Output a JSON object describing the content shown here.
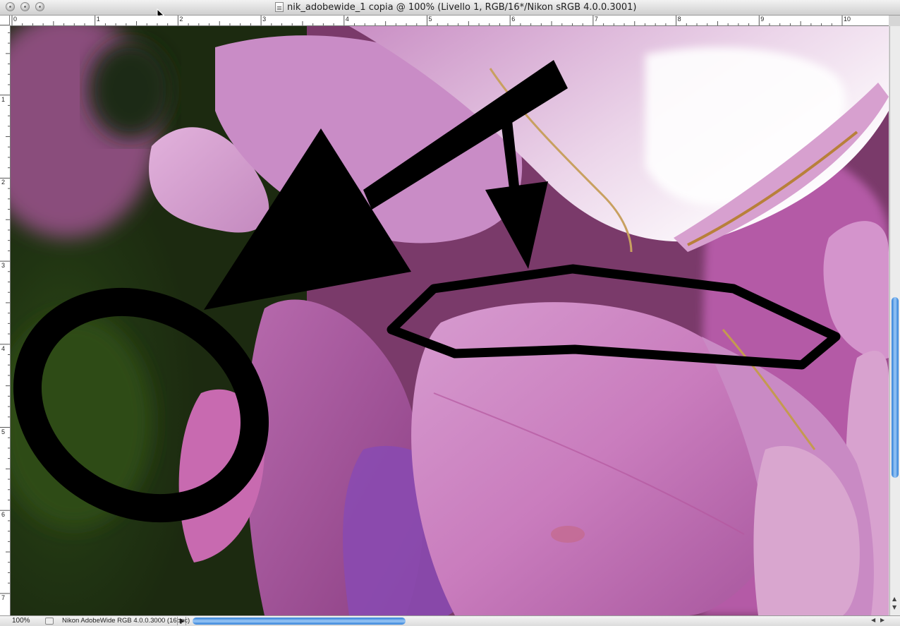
{
  "window": {
    "title": "nik_adobewide_1 copia @ 100% (Livello 1, RGB/16*/Nikon sRGB 4.0.0.3001)"
  },
  "ruler": {
    "top_labels": [
      "0",
      "1",
      "2",
      "3",
      "4",
      "5",
      "6",
      "7",
      "8",
      "9",
      "10"
    ],
    "left_labels": [
      "1",
      "2",
      "3",
      "4",
      "5",
      "6",
      "7"
    ]
  },
  "status": {
    "zoom": "100%",
    "document_info": "Nikon AdobeWide RGB 4.0.0.3000 (16bpc)"
  },
  "icons": {
    "close": "close-button-icon",
    "minimize": "minimize-button-icon",
    "zoom": "zoom-button-icon",
    "document": "document-icon",
    "cursor": "arrow-cursor-icon"
  },
  "colors": {
    "scroll_accent": "#2f7fd8",
    "petal": "#c86ab0",
    "annotation": "#000000"
  }
}
